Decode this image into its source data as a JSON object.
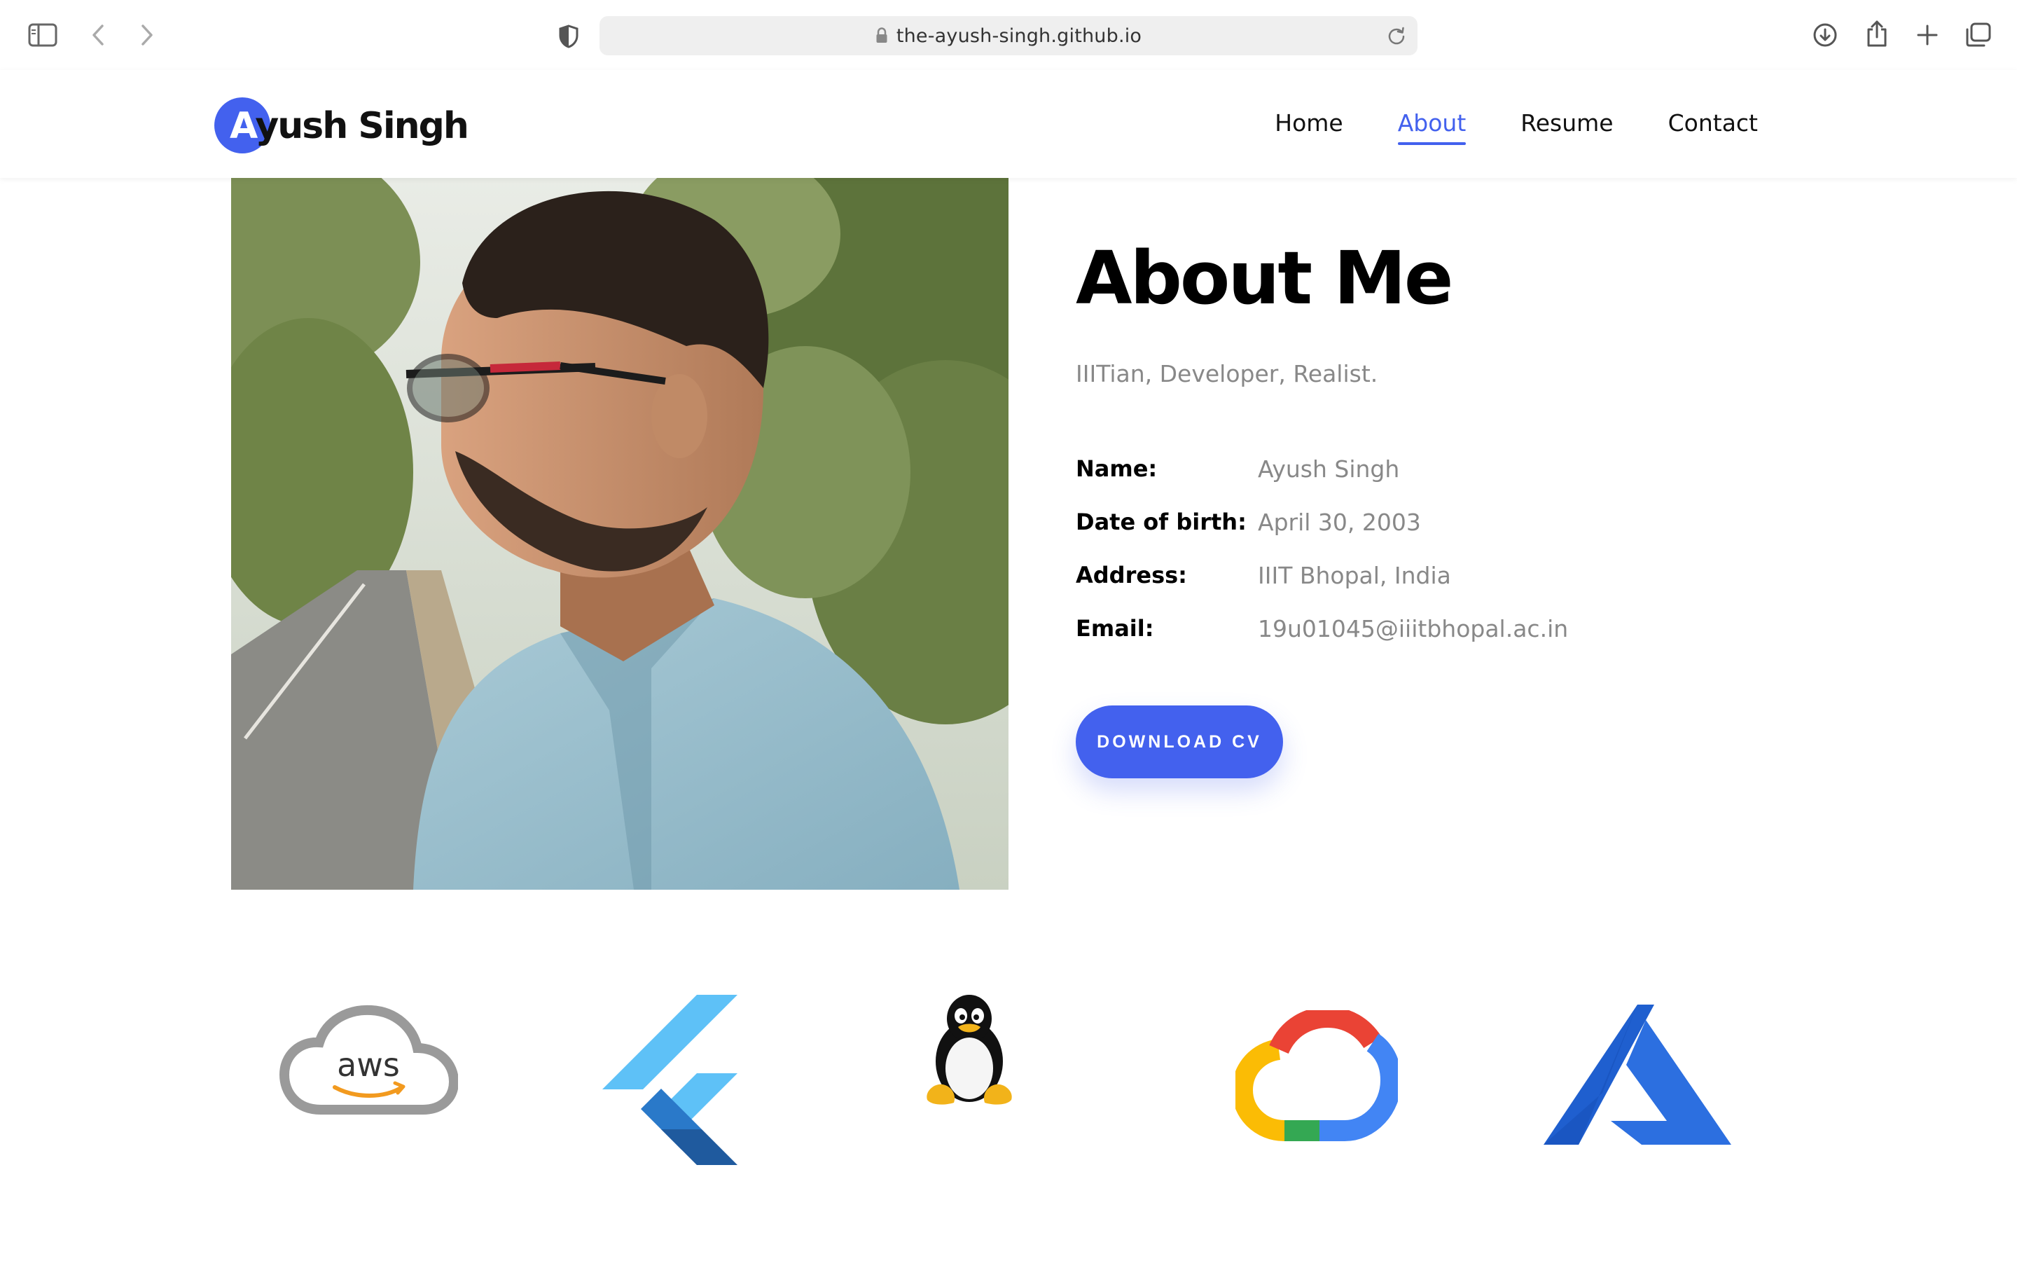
{
  "browser": {
    "url": "the-ayush-singh.github.io",
    "icons": [
      "sidebar-icon",
      "back-icon",
      "forward-icon",
      "shield-icon",
      "lock-icon",
      "reload-icon",
      "download-icon",
      "share-icon",
      "new-tab-icon",
      "tabs-overview-icon"
    ]
  },
  "site": {
    "logo_first_letter": "A",
    "logo_rest": "yush Singh",
    "nav": [
      "Home",
      "About",
      "Resume",
      "Contact"
    ],
    "active_nav": "About",
    "accent_color": "#4361ee"
  },
  "about": {
    "title": "About Me",
    "tagline": "IIITian, Developer, Realist.",
    "details": [
      {
        "label": "Name:",
        "value": "Ayush Singh"
      },
      {
        "label": "Date of birth:",
        "value": "April 30, 2003"
      },
      {
        "label": "Address:",
        "value": "IIIT Bhopal, India"
      },
      {
        "label": "Email:",
        "value": "19u01045@iiitbhopal.ac.in"
      }
    ],
    "download_button": "DOWNLOAD CV"
  },
  "tech_logos": {
    "items": [
      "aws-logo",
      "flutter-logo",
      "linux-tux-logo",
      "google-cloud-logo",
      "azure-logo"
    ],
    "aws_text": "aws"
  }
}
